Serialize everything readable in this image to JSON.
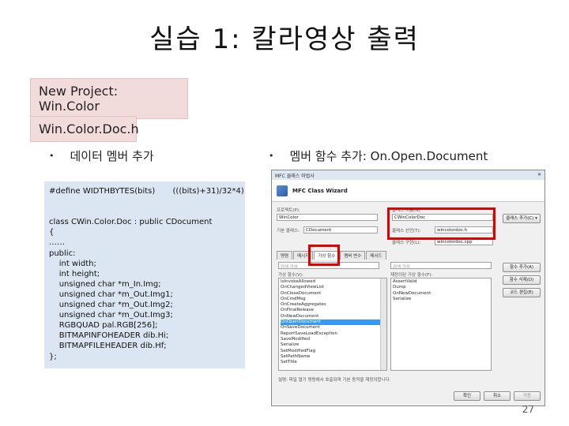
{
  "title": "실습 1:  칼라영상 출력",
  "tags": {
    "project": "New Project: Win.Color",
    "file": "Win.Color.Doc.h"
  },
  "bullets": {
    "left": "데이터 멤버 추가",
    "right": "멤버 함수 추가: On.Open.Document"
  },
  "code": [
    "#define WIDTHBYTES(bits)       (((bits)+31)/32*4)",
    "",
    "",
    "class CWin.Color.Doc : public CDocument",
    "{",
    "……",
    "public:",
    "    int width;",
    "    int height;",
    "    unsigned char *m_In.Img;",
    "    unsigned char *m_Out.Img1;",
    "    unsigned char *m_Out.Img2;",
    "    unsigned char *m_Out.Img3;",
    "    RGBQUAD pal.RGB[256];",
    "    BITMAPINFOHEADER dib.Hi;",
    "    BITMAPFILEHEADER dib.Hf;",
    "};"
  ],
  "dialog": {
    "titlebar": "MFC 클래스 마법사",
    "header_title": "MFC Class Wizard",
    "project_label": "프로젝트(P):",
    "project_value": "WinColor",
    "classname_label": "클래스 이름(N):",
    "classname_value": "CWinColorDoc",
    "baseclass_label": "기본 클래스:",
    "baseclass_value": "CDocument",
    "declfile_label": "클래스 선언(T):",
    "declfile_value": "wincolordoc.h",
    "implfile_label": "클래스 구현(L):",
    "implfile_value": "wincolordoc.cpp",
    "addclass_button": "클래스 추가(C) ▾",
    "tabs": [
      "명령",
      "메시지",
      "가상 함수",
      "멤버 변수",
      "메서드"
    ],
    "active_tab": 2,
    "search_left": "검색 가상",
    "search_right": "검색 가상",
    "left_list_label": "가상 함수(V):",
    "right_list_label": "재정의된 가상 함수(F):",
    "left_items": [
      "IsInvokeAllowed",
      "OnChangedViewList",
      "OnCloseDocument",
      "OnCmdMsg",
      "OnCreateAggregates",
      "OnFinalRelease",
      "OnNewDocument",
      "OnOpenDocument",
      "OnSaveDocument",
      "ReportSaveLoadException",
      "SaveModified",
      "Serialize",
      "SetModifiedFlag",
      "SetPathName",
      "SetTitle"
    ],
    "selected_item": "OnOpenDocument",
    "right_items": [
      "AssertValid",
      "Dump",
      "OnNewDocument",
      "Serialize"
    ],
    "buttons": [
      "함수 추가(A)",
      "함수 삭제(D)",
      "코드 편집(E)"
    ],
    "description": "설명:  파일 열기 명령에서 호출되며 기본 동작을 재정의합니다.",
    "footer_buttons": [
      "확인",
      "취소",
      "적용"
    ]
  },
  "page_number": "27",
  "colors": {
    "tag_bg": "#f2dcdb",
    "code_bg": "#dce6f2",
    "highlight": "#e00000",
    "selection": "#3399ff"
  }
}
